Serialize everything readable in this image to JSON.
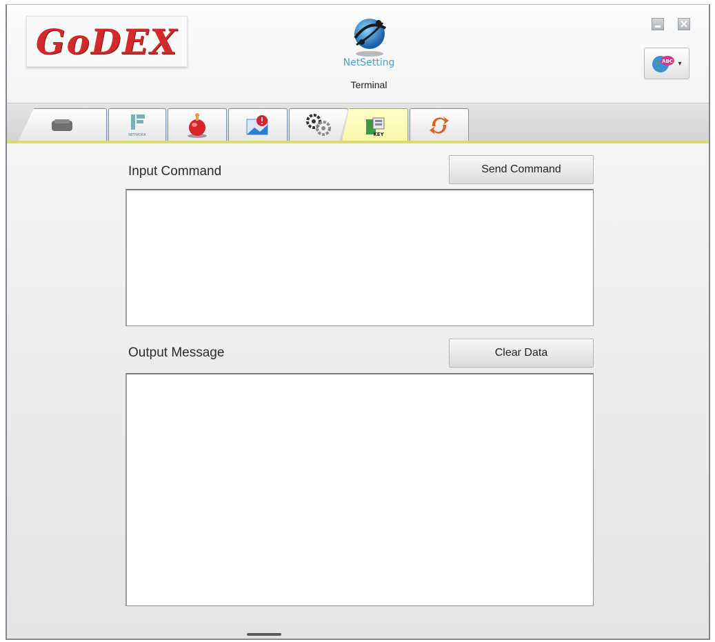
{
  "header": {
    "logo_text": "GoDEX",
    "app_name": "NetSetting",
    "app_subtitle": "Terminal",
    "minimize_icon": "minimize-icon",
    "close_icon": "close-icon",
    "language_icon": "globe-abc-icon",
    "language_badge": "ABC"
  },
  "tabs": [
    {
      "name": "printer-icon"
    },
    {
      "name": "network-icon",
      "caption": "NETWORK"
    },
    {
      "name": "alert-bell-icon"
    },
    {
      "name": "mail-alert-icon"
    },
    {
      "name": "settings-gears-icon"
    },
    {
      "name": "terminal-key-icon",
      "caption": "KEY",
      "active": true
    },
    {
      "name": "refresh-icon"
    }
  ],
  "input": {
    "label": "Input Command",
    "button_label": "Send Command",
    "value": ""
  },
  "output": {
    "label": "Output Message",
    "button_label": "Clear Data",
    "value": ""
  },
  "colors": {
    "logo": "#d22a2a",
    "active_tab": "#f7f7a8",
    "tab_underline": "#dcdb6e",
    "tab_border": "#7b8fb2"
  }
}
